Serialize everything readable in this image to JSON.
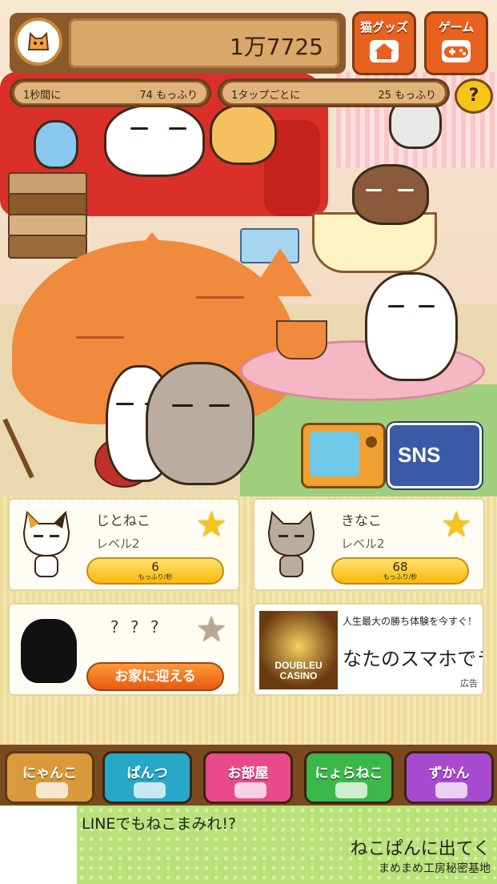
{
  "header": {
    "score": "1万7725",
    "goods_button": "猫グッズ",
    "game_button": "ゲーム"
  },
  "rates": {
    "per_second_label": "1秒間に",
    "per_second_value": "74 もっふり",
    "per_tap_label": "1タップごとに",
    "per_tap_value": "25 もっふり",
    "help": "?"
  },
  "scene": {
    "sns_label": "SNS"
  },
  "cats": [
    {
      "name": "じとねこ",
      "level": "レベル2",
      "value": "6",
      "unit": "もっふり/秒"
    },
    {
      "name": "きなこ",
      "level": "レベル2",
      "value": "68",
      "unit": "もっふり/秒"
    },
    {
      "name": "? ? ?",
      "button": "お家に迎える"
    }
  ],
  "ad": {
    "headline": "人生最大の勝ち体験を今すぐ！",
    "body": "なたのスマホでラ",
    "image_text": "DOUBLEU\nCASINO",
    "tag": "広告"
  },
  "nav": [
    {
      "label": "にゃんこ",
      "color": "#e0a040"
    },
    {
      "label": "ぱんつ",
      "color": "#27a8c8"
    },
    {
      "label": "お部屋",
      "color": "#e84a8a"
    },
    {
      "label": "にょらねこ",
      "color": "#3cb84a"
    },
    {
      "label": "ずかん",
      "color": "#a84ad0"
    }
  ],
  "banner": {
    "line1": "LINEでもねこまみれ!?",
    "line2": "ねこぱんに出てく",
    "line3": "まめまめ工房秘密基地"
  }
}
